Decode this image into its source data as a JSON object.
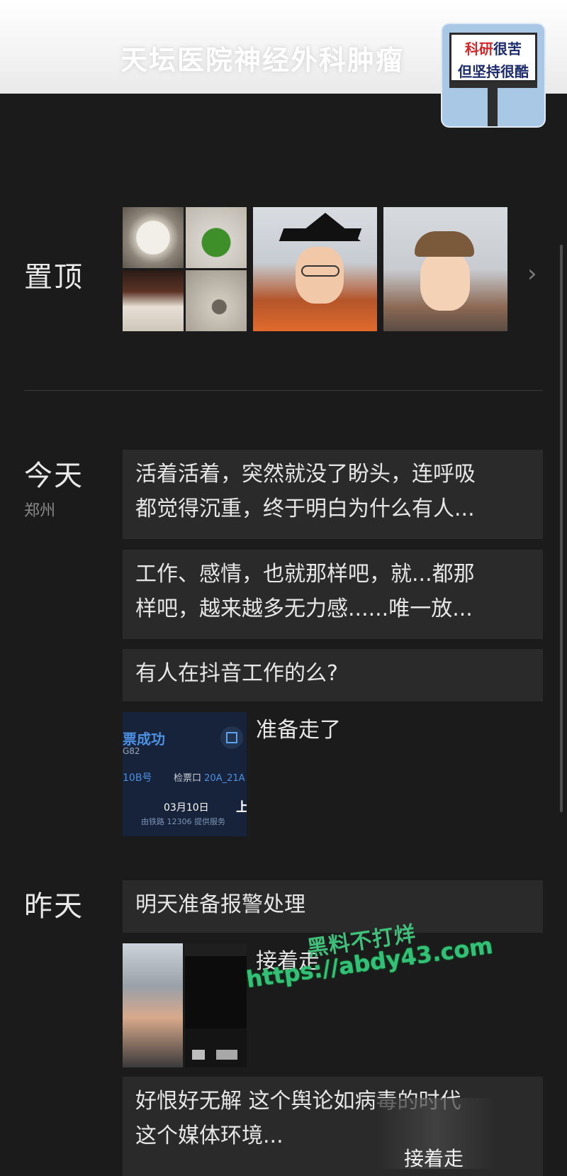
{
  "header": {
    "title": "天坛医院神经外科肿瘤",
    "avatar_sign_line1_red": "科研",
    "avatar_sign_line1_rest": "很苦",
    "avatar_sign_line2": "但坚持很酷"
  },
  "pinned": {
    "label": "置顶"
  },
  "today": {
    "label": "今天",
    "location": "郑州",
    "posts": [
      {
        "line1": "活着活着，突然就没了盼头，连呼吸",
        "line2": "都觉得沉重，终于明白为什么有人..."
      },
      {
        "line1": "工作、感情，也就那样吧，就...都那",
        "line2": "样吧，越来越多无力感......唯一放..."
      },
      {
        "line1": "有人在抖音工作的么?"
      }
    ],
    "ticket_post": {
      "caption": "准备走了",
      "ticket": {
        "status": "票成功",
        "train": "G82",
        "seat": "10B号",
        "gate_label": "检票口",
        "gate": "20A_21A",
        "date": "03月10日",
        "time_prefix": "上",
        "provider": "由铁路 12306 提供服务"
      }
    }
  },
  "yesterday": {
    "label": "昨天",
    "posts": [
      {
        "line1": "明天准备报警处理"
      },
      {
        "line1": "好恨好无解 这个舆论如病毒的时代",
        "line2": "这个媒体环境..."
      }
    ],
    "photo_post": {
      "caption": "接着走"
    },
    "bottom_overlay_label": "接着走"
  },
  "watermark": {
    "line1": "黑料不打烊",
    "line2": "https://abdy43.com"
  },
  "colors": {
    "background": "#1b1b1b",
    "card": "#2a2a2a",
    "text": "#e6e6e6",
    "watermark": "#35c07a"
  }
}
